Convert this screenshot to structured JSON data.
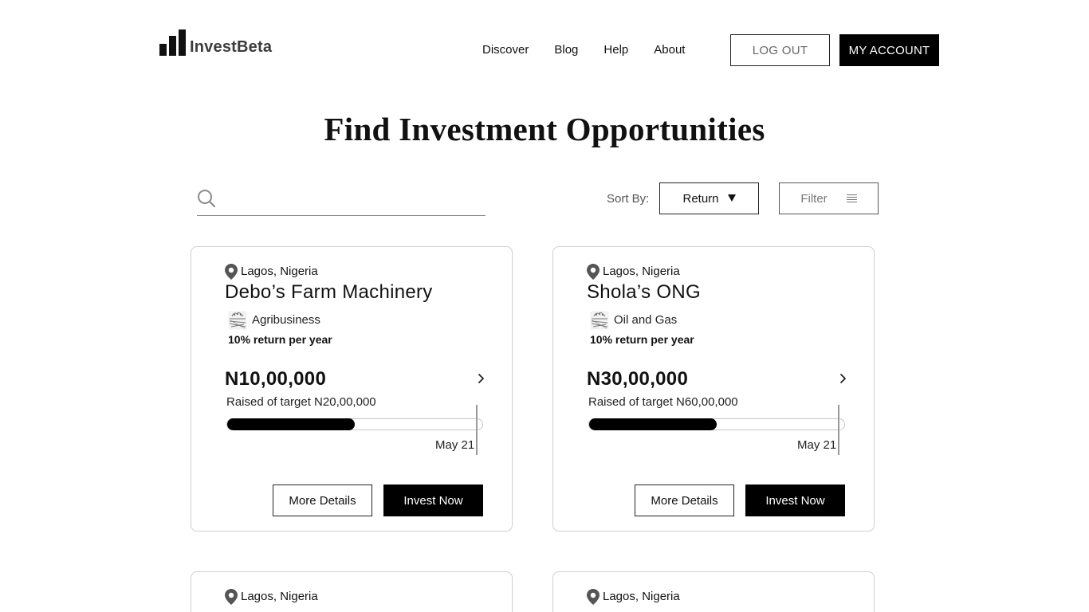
{
  "header": {
    "logo_text": "InvestBeta",
    "nav": [
      "Discover",
      "Blog",
      "Help",
      "About"
    ],
    "logout_label": "LOG OUT",
    "account_label": "MY ACCOUNT"
  },
  "page": {
    "title": "Find Investment Opportunities"
  },
  "search": {
    "value": "",
    "placeholder": ""
  },
  "sort": {
    "label": "Sort By:",
    "selected": "Return"
  },
  "filter": {
    "label": "Filter"
  },
  "cards": [
    {
      "location": "Lagos, Nigeria",
      "title": "Debo’s Farm Machinery",
      "category": "Agribusiness",
      "return_text": "10% return per year",
      "amount": "N10,00,000",
      "raised_text": "Raised of target N20,00,000",
      "progress": 0.5,
      "date": "May 21",
      "details_label": "More Details",
      "invest_label": "Invest Now"
    },
    {
      "location": "Lagos, Nigeria",
      "title": "Shola’s ONG",
      "category": "Oil and Gas",
      "return_text": "10% return per year",
      "amount": "N30,00,000",
      "raised_text": "Raised of target N60,00,000",
      "progress": 0.5,
      "date": "May 21",
      "details_label": "More Details",
      "invest_label": "Invest Now"
    },
    {
      "location": "Lagos, Nigeria"
    },
    {
      "location": "Lagos, Nigeria"
    }
  ],
  "icons": {
    "search": "search-icon",
    "sort_caret": "caret-down-icon",
    "filter": "filter-lines-icon",
    "location": "location-pin-icon",
    "category": "farm-field-icon",
    "arrow": "chevron-right-icon"
  },
  "colors": {
    "primary": "#000000",
    "border": "#cfcfcf",
    "text": "#111111"
  }
}
